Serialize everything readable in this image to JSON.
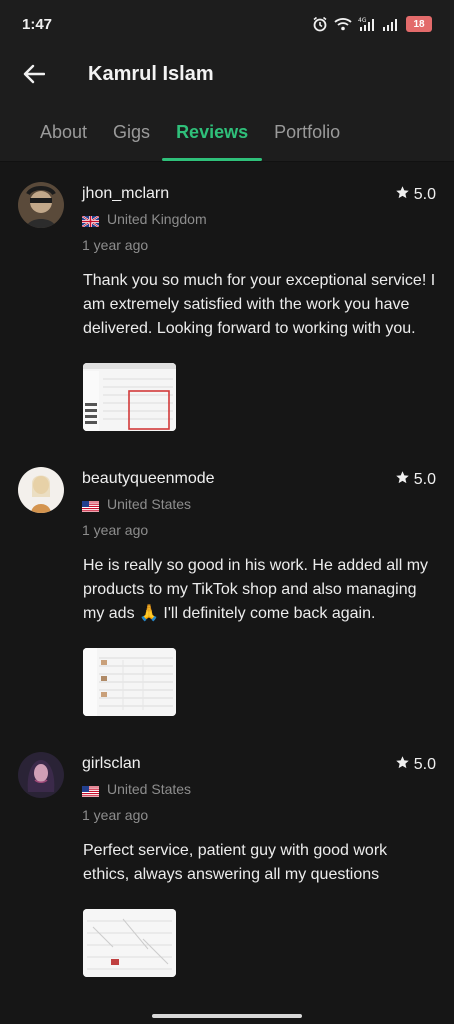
{
  "status": {
    "time": "1:47",
    "network1": "4G",
    "network2": "",
    "battery": "18"
  },
  "header": {
    "title": "Kamrul Islam"
  },
  "tabs": [
    {
      "label": "About",
      "active": false
    },
    {
      "label": "Gigs",
      "active": false
    },
    {
      "label": "Reviews",
      "active": true
    },
    {
      "label": "Portfolio",
      "active": false
    }
  ],
  "reviews": [
    {
      "username": "jhon_mclarn",
      "country": "United Kingdom",
      "flag": "uk-flag-icon",
      "ago": "1 year ago",
      "rating": "5.0",
      "text": "Thank you so much for your exceptional service! I am extremely satisfied with the work you have delivered. Looking forward to working with you."
    },
    {
      "username": "beautyqueenmode",
      "country": "United States",
      "flag": "us-flag-icon",
      "ago": "1 year ago",
      "rating": "5.0",
      "text": "He is really so good in his work. He added all my products to my TikTok shop and also managing my ads 🙏 I'll definitely come back again."
    },
    {
      "username": "girlsclan",
      "country": "United States",
      "flag": "us-flag-icon",
      "ago": "1 year ago",
      "rating": "5.0",
      "text": "Perfect service, patient guy with good work ethics, always answering all my questions"
    }
  ],
  "colors": {
    "accent": "#2fc07a",
    "background": "#161616",
    "muted_text": "#8d8d8d"
  }
}
